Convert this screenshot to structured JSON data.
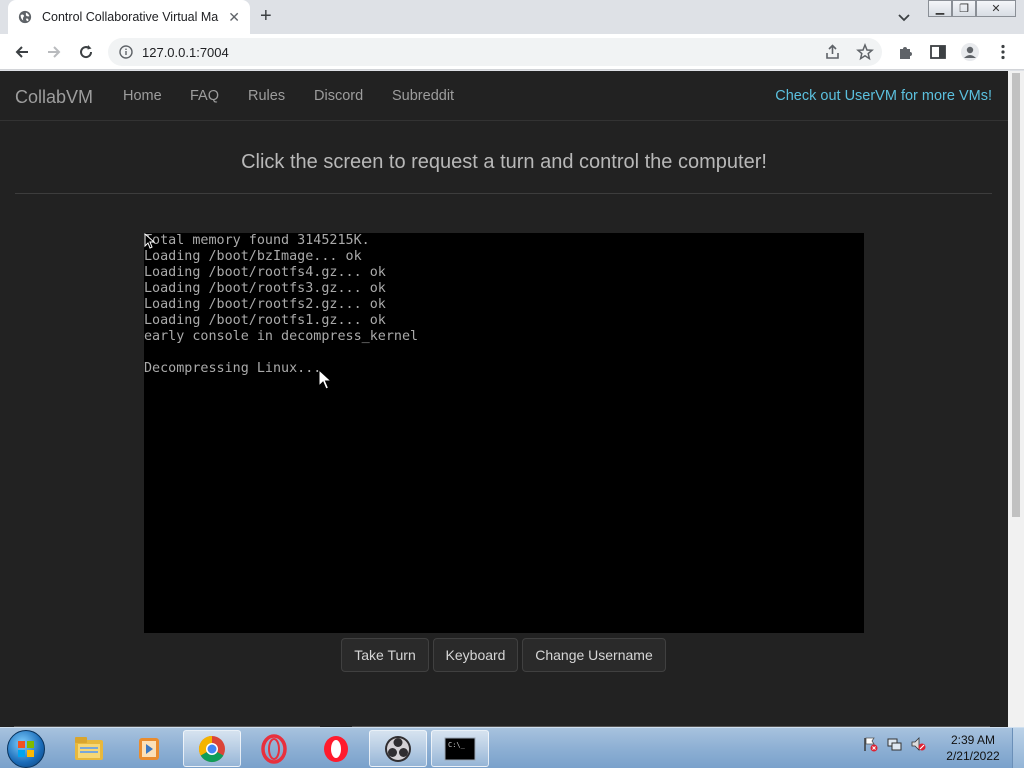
{
  "browser": {
    "tab_title": "Control Collaborative Virtual Ma",
    "new_tab_symbol": "+",
    "close_symbol": "✕",
    "url": "127.0.0.1:7004",
    "window_controls": {
      "minimize": "▁",
      "maximize": "❐",
      "close": "✕"
    }
  },
  "site": {
    "brand": "CollabVM",
    "nav": [
      "Home",
      "FAQ",
      "Rules",
      "Discord",
      "Subreddit"
    ],
    "nav_right": "Check out UserVM for more VMs!",
    "prompt": "Click the screen to request a turn and control the computer!",
    "accent_color": "#5bc0de"
  },
  "vm_console": {
    "lines": [
      "Total memory found 3145215K.",
      "Loading /boot/bzImage... ok",
      "Loading /boot/rootfs4.gz... ok",
      "Loading /boot/rootfs3.gz... ok",
      "Loading /boot/rootfs2.gz... ok",
      "Loading /boot/rootfs1.gz... ok",
      "early console in decompress_kernel",
      "",
      "Decompressing Linux..."
    ]
  },
  "buttons": {
    "take_turn": "Take Turn",
    "keyboard": "Keyboard",
    "change_username": "Change Username"
  },
  "taskbar": {
    "apps": [
      "explorer-icon",
      "media-player-icon",
      "chrome-icon",
      "opera-gx-icon",
      "opera-icon",
      "obs-icon",
      "cmd-icon"
    ],
    "cmd_label": "C:\\_",
    "clock_time": "2:39 AM",
    "clock_date": "2/21/2022"
  }
}
